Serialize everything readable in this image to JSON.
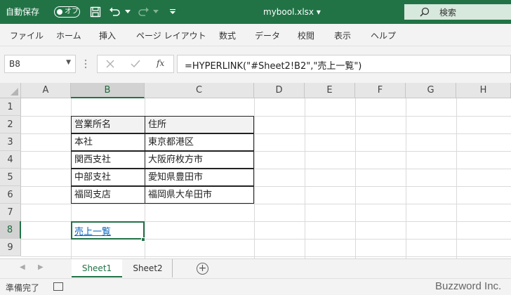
{
  "titlebar": {
    "autosave_label": "自動保存",
    "autosave_state": "オフ",
    "file_name": "mybool.xlsx",
    "file_dropdown": "▾",
    "search_placeholder": "検索"
  },
  "ribbon": {
    "tabs": [
      "ファイル",
      "ホーム",
      "挿入",
      "ページ レイアウト",
      "数式",
      "データ",
      "校閲",
      "表示",
      "ヘルプ"
    ]
  },
  "formula_bar": {
    "name_box": "B8",
    "fx_label": "fx",
    "formula": "=HYPERLINK(\"#Sheet2!B2\",\"売上一覧\")"
  },
  "grid": {
    "columns": [
      "A",
      "B",
      "C",
      "D",
      "E",
      "F",
      "G",
      "H"
    ],
    "rows": [
      "1",
      "2",
      "3",
      "4",
      "5",
      "6",
      "7",
      "8",
      "9"
    ],
    "table": {
      "header": [
        "営業所名",
        "住所"
      ],
      "rows": [
        [
          "本社",
          "東京都港区"
        ],
        [
          "関西支社",
          "大阪府枚方市"
        ],
        [
          "中部支社",
          "愛知県豊田市"
        ],
        [
          "福岡支店",
          "福岡県大牟田市"
        ]
      ]
    },
    "link_text": "売上一覧"
  },
  "sheet_tabs": [
    "Sheet1",
    "Sheet2"
  ],
  "status": {
    "ready": "準備完了"
  },
  "watermark": "Buzzword Inc.",
  "colors": {
    "excel_green": "#217346",
    "link_blue": "#0563c1"
  }
}
